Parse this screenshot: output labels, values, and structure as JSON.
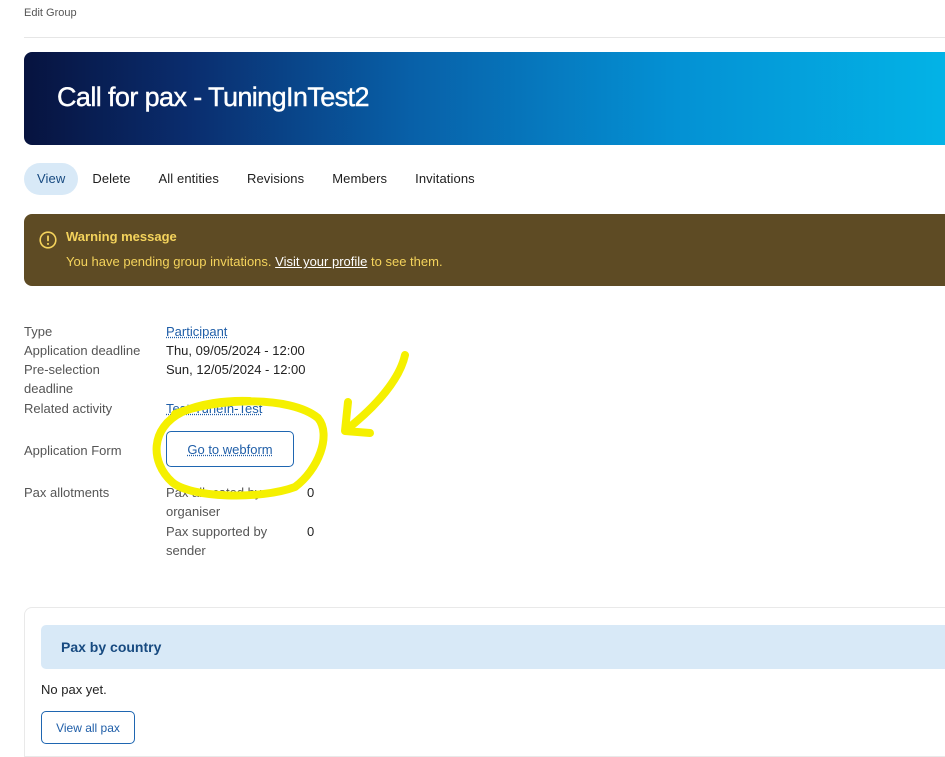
{
  "breadcrumb": "Edit Group",
  "page_title": "Call for pax - TuningInTest2",
  "tabs": [
    {
      "label": "View",
      "active": true
    },
    {
      "label": "Delete"
    },
    {
      "label": "All entities"
    },
    {
      "label": "Revisions"
    },
    {
      "label": "Members"
    },
    {
      "label": "Invitations"
    }
  ],
  "warning": {
    "title": "Warning message",
    "text_before": "You have pending group invitations.",
    "link": "Visit your profile",
    "text_after": "to see them.",
    "icon": "exclamation-circle-icon",
    "color": "#5e4b24"
  },
  "details": {
    "type_label": "Type",
    "type_value": "Participant",
    "app_deadline_label": "Application deadline",
    "app_deadline_value": "Thu, 09/05/2024 - 12:00",
    "preselect_label_1": "Pre-selection",
    "preselect_label_2": "deadline",
    "preselect_value": "Sun, 12/05/2024 - 12:00",
    "activity_label": "Related activity",
    "activity_value": "Test-TuneIn-Test",
    "form_label": "Application Form",
    "form_button": "Go to webform",
    "allot_label": "Pax allotments",
    "allocated_label_1": "Pax allocated by",
    "allocated_label_2": "organiser",
    "allocated_value": "0",
    "supported_label_1": "Pax supported by",
    "supported_label_2": "sender",
    "supported_value": "0"
  },
  "pax_card": {
    "title": "Pax by country",
    "empty": "No pax yet.",
    "button": "View all pax"
  },
  "annotation_color": "#f5f000"
}
